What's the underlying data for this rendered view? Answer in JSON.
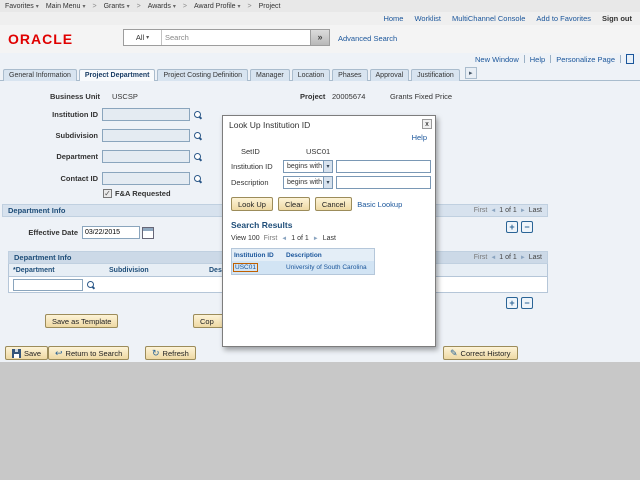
{
  "breadcrumb": {
    "items": [
      "Favorites",
      "Main Menu",
      "Grants",
      "Awards",
      "Award Profile",
      "Project"
    ],
    "separator": ">"
  },
  "top_links": {
    "home": "Home",
    "worklist": "Worklist",
    "multichannel": "MultiChannel Console",
    "add_to_favorites": "Add to Favorites",
    "sign_out": "Sign out"
  },
  "brand": {
    "logo": "ORACLE"
  },
  "search": {
    "scope": "All",
    "placeholder": "Search",
    "go": "»",
    "advanced": "Advanced Search"
  },
  "page_links": {
    "new_window": "New Window",
    "help": "Help",
    "personalize": "Personalize Page"
  },
  "tabs": [
    {
      "label": "General Information"
    },
    {
      "label": "Project Department"
    },
    {
      "label": "Project Costing Definition"
    },
    {
      "label": "Manager"
    },
    {
      "label": "Location"
    },
    {
      "label": "Phases"
    },
    {
      "label": "Approval"
    },
    {
      "label": "Justification"
    }
  ],
  "header_fields": {
    "business_unit_label": "Business Unit",
    "business_unit_value": "USCSP",
    "project_label": "Project",
    "project_value": "20005674",
    "project_desc": "Grants Fixed Price"
  },
  "fields": {
    "institution_id": "Institution ID",
    "subdivision": "Subdivision",
    "department": "Department",
    "contact_id": "Contact ID",
    "fa_requested": "F&A Requested"
  },
  "department_info": {
    "title": "Department Info",
    "effective_date_label": "Effective Date",
    "effective_date_value": "03/22/2015",
    "pagination": {
      "first": "First",
      "page": "1 of 1",
      "last": "Last"
    },
    "grid": {
      "title": "Department Info",
      "columns": [
        "*Department",
        "Subdivision",
        "Description"
      ],
      "pagination": {
        "first": "First",
        "page": "1 of 1",
        "last": "Last"
      }
    }
  },
  "actions": {
    "save_as_template": "Save as Template",
    "copy_button": "Cop"
  },
  "toolbar": {
    "save": "Save",
    "return_to_search": "Return to Search",
    "refresh": "Refresh",
    "correct_history": "Correct History"
  },
  "modal": {
    "title": "Look Up Institution ID",
    "close": "x",
    "help": "Help",
    "setid_label": "SetID",
    "setid_value": "USC01",
    "institution_id_label": "Institution ID",
    "description_label": "Description",
    "operator": "begins with",
    "look_up": "Look Up",
    "clear": "Clear",
    "cancel": "Cancel",
    "basic_lookup": "Basic Lookup",
    "results_title": "Search Results",
    "view": "View 100",
    "pagination": {
      "first": "First",
      "page": "1 of 1",
      "last": "Last"
    },
    "columns": [
      "Institution ID",
      "Description"
    ],
    "rows": [
      {
        "institution_id": "USC01",
        "description": "University of South Carolina"
      }
    ]
  },
  "colors": {
    "link": "#1b569b",
    "accent": "#2a6496",
    "oracle_red": "#e00000"
  }
}
